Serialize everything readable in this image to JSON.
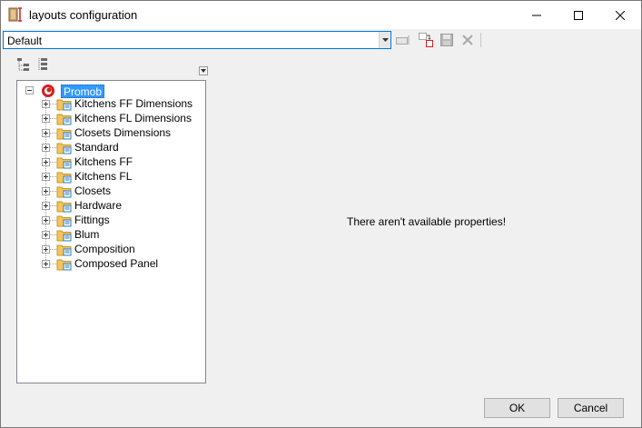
{
  "window": {
    "title": "layouts configuration"
  },
  "toolbar": {
    "layout_value": "Default",
    "icons": [
      "rename-icon",
      "copy-icon",
      "save-icon",
      "delete-icon"
    ]
  },
  "tree_tools": {
    "icons": [
      "collapse-tree-icon",
      "expand-tree-icon"
    ]
  },
  "tree": {
    "root": "Promob",
    "items": [
      "Kitchens FF Dimensions",
      "Kitchens FL Dimensions",
      "Closets Dimensions",
      "Standard",
      "Kitchens FF",
      "Kitchens FL",
      "Closets",
      "Hardware",
      "Fittings",
      "Blum",
      "Composition",
      "Composed Panel"
    ]
  },
  "properties": {
    "empty_message": "There aren't available properties!"
  },
  "footer": {
    "ok_label": "OK",
    "cancel_label": "Cancel"
  },
  "colors": {
    "selection": "#3399ff",
    "focus_border": "#0078d7",
    "folder": "#f5c45a"
  }
}
